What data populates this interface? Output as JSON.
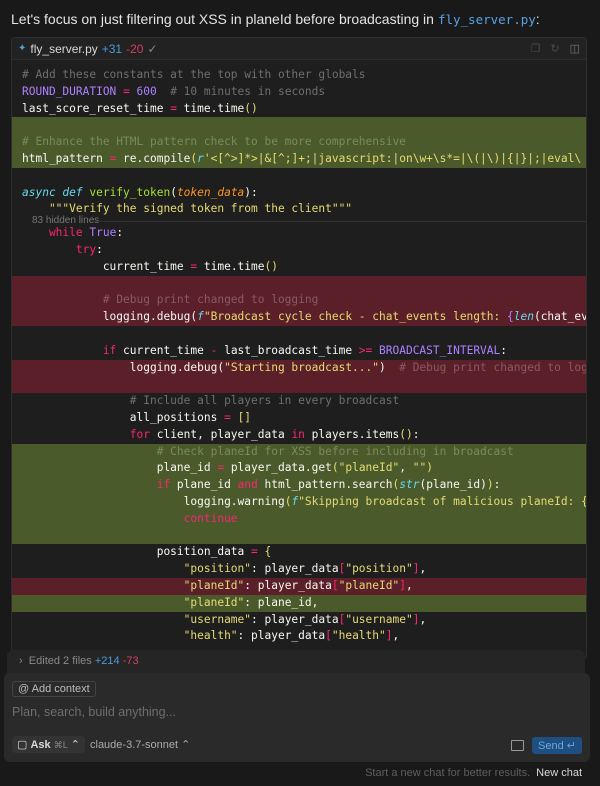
{
  "intro": {
    "text": "Let's focus on just filtering out XSS in planeId before broadcasting in",
    "file": "fly_server.py",
    "suffix": ":"
  },
  "codeblock": {
    "filename": "fly_server.py",
    "added": "+31",
    "removed": "-20",
    "status_icon": "check-icon",
    "hidden_lines": "83 hidden lines",
    "lines_top": [
      {
        "bg": "",
        "t": [
          [
            "c",
            "# Add these constants at the top with other globals"
          ]
        ]
      },
      {
        "bg": "",
        "t": [
          [
            "p",
            "ROUND_DURATION"
          ],
          [
            "o",
            " = "
          ],
          [
            "p",
            "600"
          ],
          [
            "c",
            "  # 10 minutes in seconds"
          ]
        ]
      },
      {
        "bg": "",
        "t": [
          [
            "t",
            "last_score_reset_time "
          ],
          [
            "o",
            "="
          ],
          [
            "t",
            " time.time"
          ],
          [
            "b",
            "()"
          ]
        ]
      },
      {
        "bg": "add",
        "t": []
      },
      {
        "bg": "add",
        "t": [
          [
            "c",
            "# Enhance the HTML pattern check to be more comprehensive"
          ]
        ]
      },
      {
        "bg": "add",
        "t": [
          [
            "t",
            "html_pattern "
          ],
          [
            "o",
            "="
          ],
          [
            "t",
            " re.compile"
          ],
          [
            "b",
            "("
          ],
          [
            "i",
            "r"
          ],
          [
            "s",
            "'<[^>]*>|&[^;]+;|javascript:|on\\w+\\s*=|\\(|\\)|{|}|;|eval\\"
          ]
        ]
      },
      {
        "bg": "",
        "t": []
      },
      {
        "bg": "",
        "t": [
          [
            "i",
            "async def "
          ],
          [
            "f",
            "verify_token"
          ],
          [
            "t",
            "("
          ],
          [
            "a",
            "token_data"
          ],
          [
            "t",
            "):"
          ]
        ]
      },
      {
        "bg": "",
        "t": [
          [
            "s",
            "    \"\"\"Verify the signed token from the client\"\"\""
          ]
        ]
      }
    ],
    "lines_bottom": [
      {
        "bg": "",
        "t": [
          [
            "k",
            "    while "
          ],
          [
            "p",
            "True"
          ],
          [
            "t",
            ":"
          ]
        ]
      },
      {
        "bg": "",
        "t": [
          [
            "k",
            "        try"
          ],
          [
            "t",
            ":"
          ]
        ]
      },
      {
        "bg": "",
        "t": [
          [
            "t",
            "            current_time "
          ],
          [
            "o",
            "="
          ],
          [
            "t",
            " time.time"
          ],
          [
            "b",
            "()"
          ]
        ]
      },
      {
        "bg": "del",
        "t": []
      },
      {
        "bg": "del",
        "t": [
          [
            "c",
            "            # Debug print changed to logging"
          ]
        ]
      },
      {
        "bg": "del",
        "t": [
          [
            "t",
            "            logging.debug("
          ],
          [
            "i",
            "f"
          ],
          [
            "s",
            "\"Broadcast cycle check - chat_events length: "
          ],
          [
            "p",
            "{"
          ],
          [
            "i",
            "len"
          ],
          [
            "t",
            "(chat_events"
          ]
        ]
      },
      {
        "bg": "",
        "t": []
      },
      {
        "bg": "",
        "t": [
          [
            "k",
            "            if"
          ],
          [
            "t",
            " current_time "
          ],
          [
            "o",
            "-"
          ],
          [
            "t",
            " last_broadcast_time "
          ],
          [
            "o",
            ">="
          ],
          [
            "p",
            " BROADCAST_INTERVAL"
          ],
          [
            "t",
            ":"
          ]
        ]
      },
      {
        "bg": "del",
        "t": [
          [
            "t",
            "                logging.debug("
          ],
          [
            "s",
            "\"Starting broadcast...\""
          ],
          [
            "t",
            ")"
          ],
          [
            "c",
            "  # Debug print changed to logging"
          ]
        ]
      },
      {
        "bg": "del",
        "t": []
      },
      {
        "bg": "",
        "t": [
          [
            "c",
            "                # Include all players in every broadcast"
          ]
        ]
      },
      {
        "bg": "",
        "t": [
          [
            "t",
            "                all_positions "
          ],
          [
            "o",
            "="
          ],
          [
            "b",
            " []"
          ]
        ]
      },
      {
        "bg": "",
        "t": [
          [
            "k",
            "                for"
          ],
          [
            "t",
            " client, player_data "
          ],
          [
            "k",
            "in"
          ],
          [
            "t",
            " players.items"
          ],
          [
            "b",
            "()"
          ],
          [
            "t",
            ":"
          ]
        ]
      },
      {
        "bg": "add",
        "t": [
          [
            "c",
            "                    # Check planeId for XSS before including in broadcast"
          ]
        ]
      },
      {
        "bg": "add",
        "t": [
          [
            "t",
            "                    plane_id "
          ],
          [
            "o",
            "="
          ],
          [
            "t",
            " player_data.get"
          ],
          [
            "b",
            "("
          ],
          [
            "s",
            "\"planeId\""
          ],
          [
            "t",
            ", "
          ],
          [
            "s",
            "\"\""
          ],
          [
            "b",
            ")"
          ]
        ]
      },
      {
        "bg": "add",
        "t": [
          [
            "k",
            "                    if"
          ],
          [
            "t",
            " plane_id "
          ],
          [
            "k",
            "and"
          ],
          [
            "t",
            " html_pattern.search"
          ],
          [
            "b",
            "("
          ],
          [
            "i",
            "str"
          ],
          [
            "t",
            "(plane_id)"
          ],
          [
            "b",
            ")"
          ],
          [
            "t",
            ":"
          ]
        ]
      },
      {
        "bg": "add",
        "t": [
          [
            "t",
            "                        logging.warning"
          ],
          [
            "b",
            "("
          ],
          [
            "i",
            "f"
          ],
          [
            "s",
            "\"Skipping broadcast of malicious planeId: {plane_id}\""
          ]
        ]
      },
      {
        "bg": "add",
        "t": [
          [
            "k",
            "                        continue"
          ]
        ]
      },
      {
        "bg": "add",
        "t": []
      },
      {
        "bg": "",
        "t": [
          [
            "t",
            "                    position_data "
          ],
          [
            "o",
            "="
          ],
          [
            "b",
            " {"
          ]
        ]
      },
      {
        "bg": "",
        "t": [
          [
            "s",
            "                        \"position\""
          ],
          [
            "t",
            ": player_data"
          ],
          [
            "o",
            "["
          ],
          [
            "s",
            "\"position\""
          ],
          [
            "o",
            "]"
          ],
          [
            "t",
            ","
          ]
        ]
      },
      {
        "bg": "del",
        "t": [
          [
            "s",
            "                        \"planeId\""
          ],
          [
            "t",
            ": player_data"
          ],
          [
            "o",
            "["
          ],
          [
            "s",
            "\"planeId\""
          ],
          [
            "o",
            "]"
          ],
          [
            "t",
            ","
          ]
        ]
      },
      {
        "bg": "add",
        "t": [
          [
            "s",
            "                        \"planeId\""
          ],
          [
            "t",
            ": plane_id,"
          ]
        ]
      },
      {
        "bg": "",
        "t": [
          [
            "s",
            "                        \"username\""
          ],
          [
            "t",
            ": player_data"
          ],
          [
            "o",
            "["
          ],
          [
            "s",
            "\"username\""
          ],
          [
            "o",
            "]"
          ],
          [
            "t",
            ","
          ]
        ]
      },
      {
        "bg": "",
        "t": [
          [
            "s",
            "                        \"health\""
          ],
          [
            "t",
            ": player_data"
          ],
          [
            "o",
            "["
          ],
          [
            "s",
            "\"health\""
          ],
          [
            "o",
            "]"
          ],
          [
            "t",
            ","
          ]
        ]
      }
    ]
  },
  "edited": {
    "label": "Edited 2 files",
    "added": "+214",
    "removed": "-73"
  },
  "composer": {
    "add_context": "Add context",
    "placeholder": "Plan, search, build anything...",
    "mode": "Ask",
    "mode_shortcut": "⌘L",
    "model": "claude-3.7-sonnet",
    "send": "Send"
  },
  "footer": {
    "hint": "Start a new chat for better results.",
    "new_chat": "New chat"
  },
  "colors": {
    "added_bg": "#4b5a2b",
    "removed_bg": "#5a1f28",
    "accent": "#4a9be0"
  }
}
